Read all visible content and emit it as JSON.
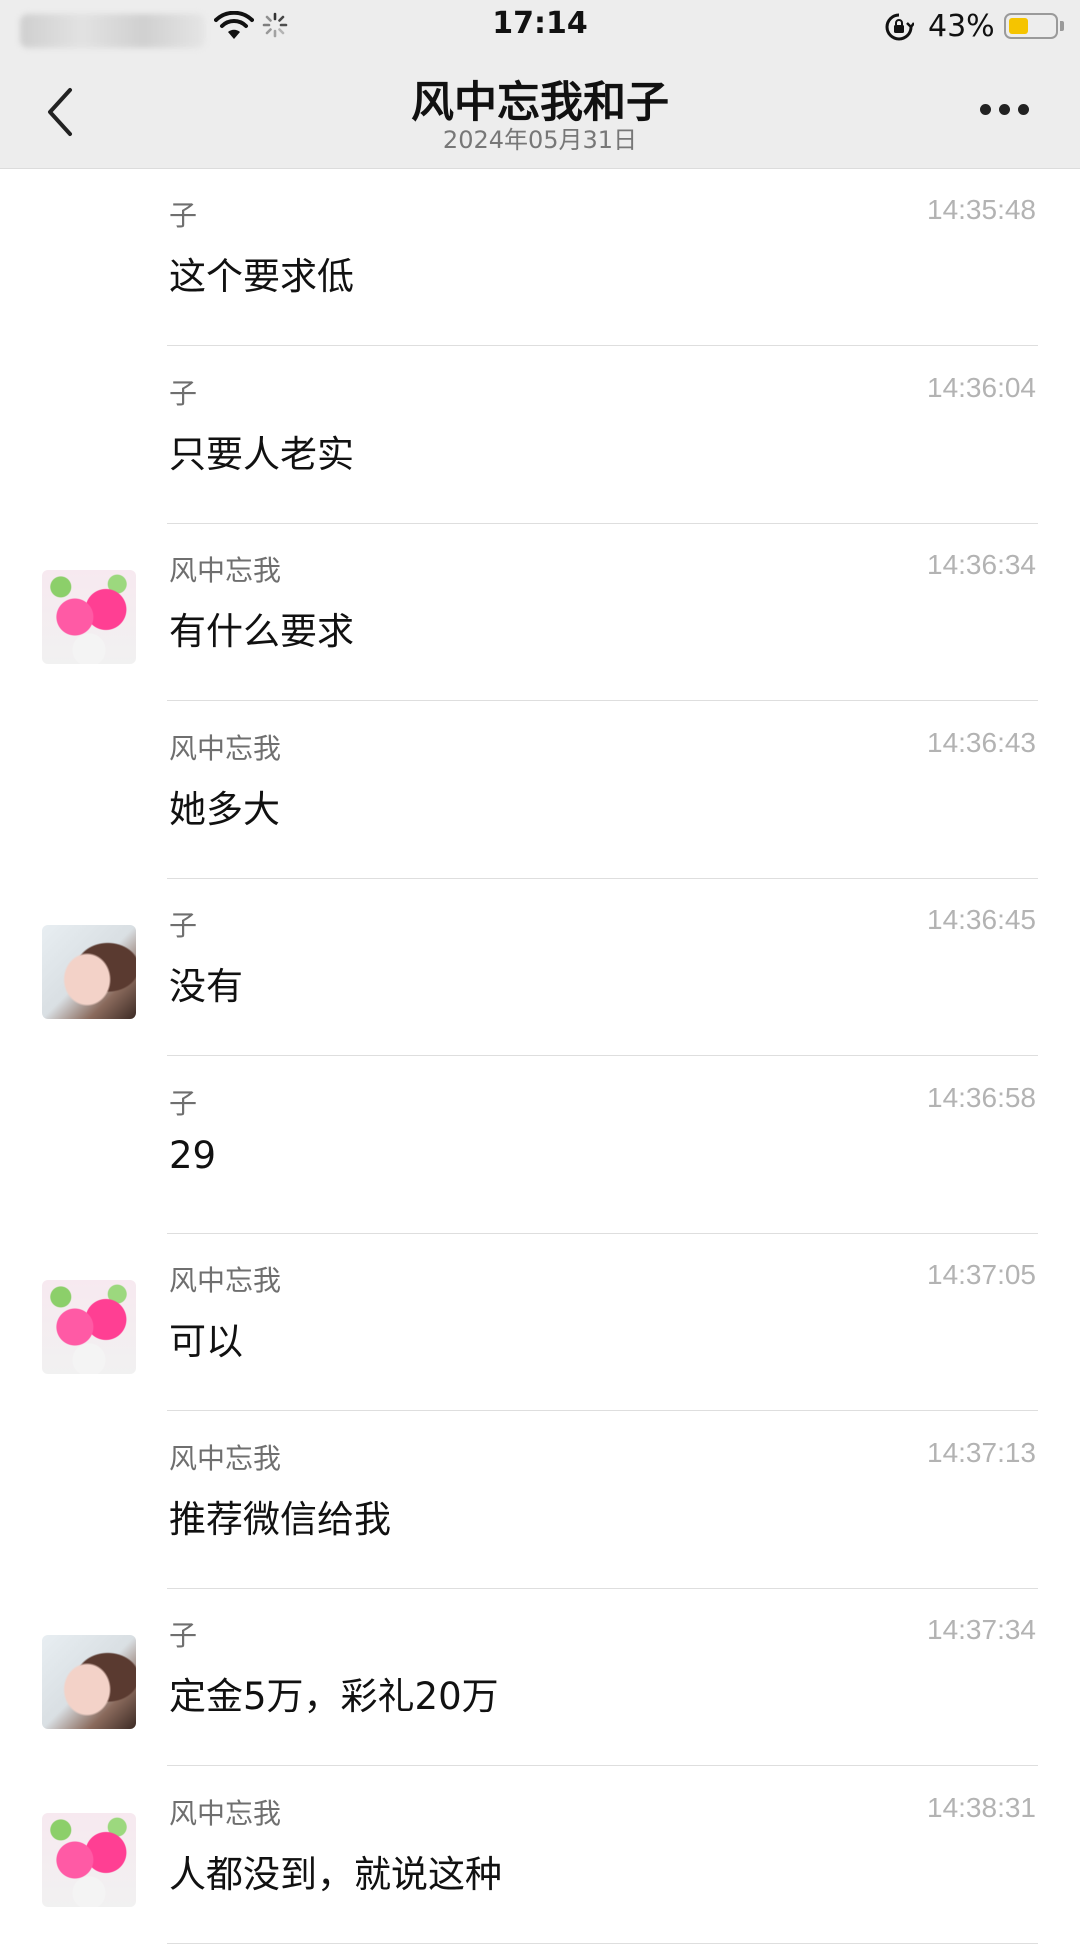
{
  "status_bar": {
    "time": "17:14",
    "battery_percent": "43%",
    "battery_level": 0.43,
    "battery_color": "#f5c400"
  },
  "nav": {
    "title": "风中忘我和子",
    "date": "2024年05月31日",
    "back_icon": "chevron-left-icon",
    "more_icon": "more-dots-icon"
  },
  "messages": [
    {
      "sender": "子",
      "time": "14:35:48",
      "text": "这个要求低",
      "avatar": "none"
    },
    {
      "sender": "子",
      "time": "14:36:04",
      "text": "只要人老实",
      "avatar": "none"
    },
    {
      "sender": "风中忘我",
      "time": "14:36:34",
      "text": "有什么要求",
      "avatar": "rose"
    },
    {
      "sender": "风中忘我",
      "time": "14:36:43",
      "text": "她多大",
      "avatar": "none"
    },
    {
      "sender": "子",
      "time": "14:36:45",
      "text": "没有",
      "avatar": "girl"
    },
    {
      "sender": "子",
      "time": "14:36:58",
      "text": "29",
      "avatar": "none"
    },
    {
      "sender": "风中忘我",
      "time": "14:37:05",
      "text": "可以",
      "avatar": "rose"
    },
    {
      "sender": "风中忘我",
      "time": "14:37:13",
      "text": "推荐微信给我",
      "avatar": "none"
    },
    {
      "sender": "子",
      "time": "14:37:34",
      "text": "定金5万，彩礼20万",
      "avatar": "girl"
    },
    {
      "sender": "风中忘我",
      "time": "14:38:31",
      "text": "人都没到，就说这种",
      "avatar": "rose"
    }
  ]
}
